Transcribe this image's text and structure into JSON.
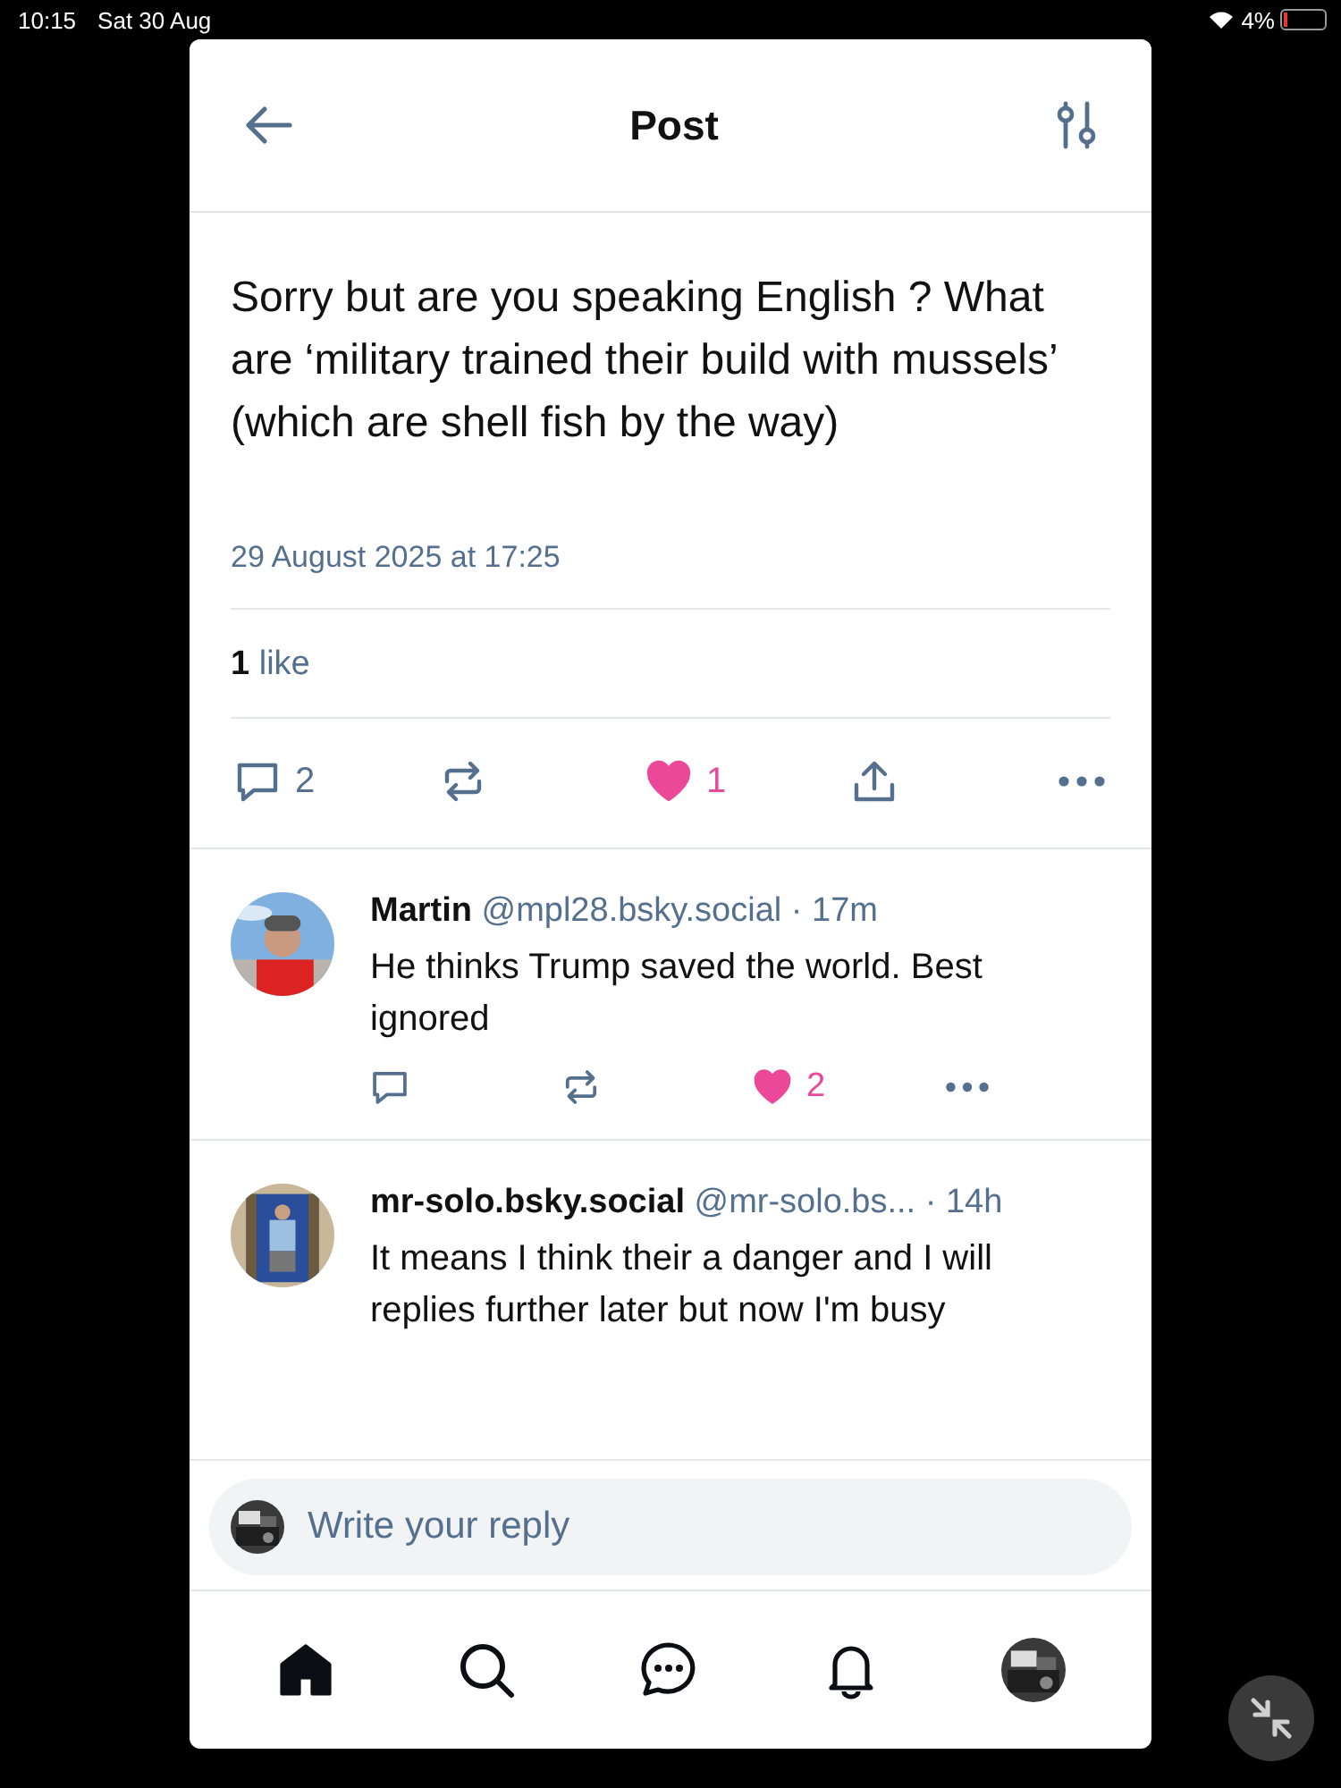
{
  "status_bar": {
    "time": "10:15",
    "date": "Sat 30 Aug",
    "battery": "4%"
  },
  "header": {
    "title": "Post"
  },
  "main_post": {
    "text": "Sorry but are you speaking English ? What are ‘military trained their build with mussels’ (which are shell fish by the way)",
    "timestamp": "29 August 2025 at 17:25",
    "like_count": "1",
    "like_label": "like",
    "reply_count": "2",
    "likes": "1",
    "liked": true
  },
  "replies": [
    {
      "name": "Martin",
      "handle": "@mpl28.bsky.social",
      "time": "· 17m",
      "text": "He thinks Trump saved the world. Best ignored",
      "likes": "2",
      "liked": true
    },
    {
      "name": "mr-solo.bsky.social",
      "handle": "@mr-solo.bs...",
      "time": "· 14h",
      "text": "It means I think their a danger and I will replies further later but now I'm busy"
    }
  ],
  "composer": {
    "placeholder": "Write your reply"
  },
  "tab_bar": [
    {
      "kind": "home",
      "selected": true
    },
    {
      "kind": "search",
      "selected": false
    },
    {
      "kind": "chat",
      "selected": false
    },
    {
      "kind": "bell",
      "selected": false
    },
    {
      "kind": "profile",
      "selected": false
    }
  ]
}
